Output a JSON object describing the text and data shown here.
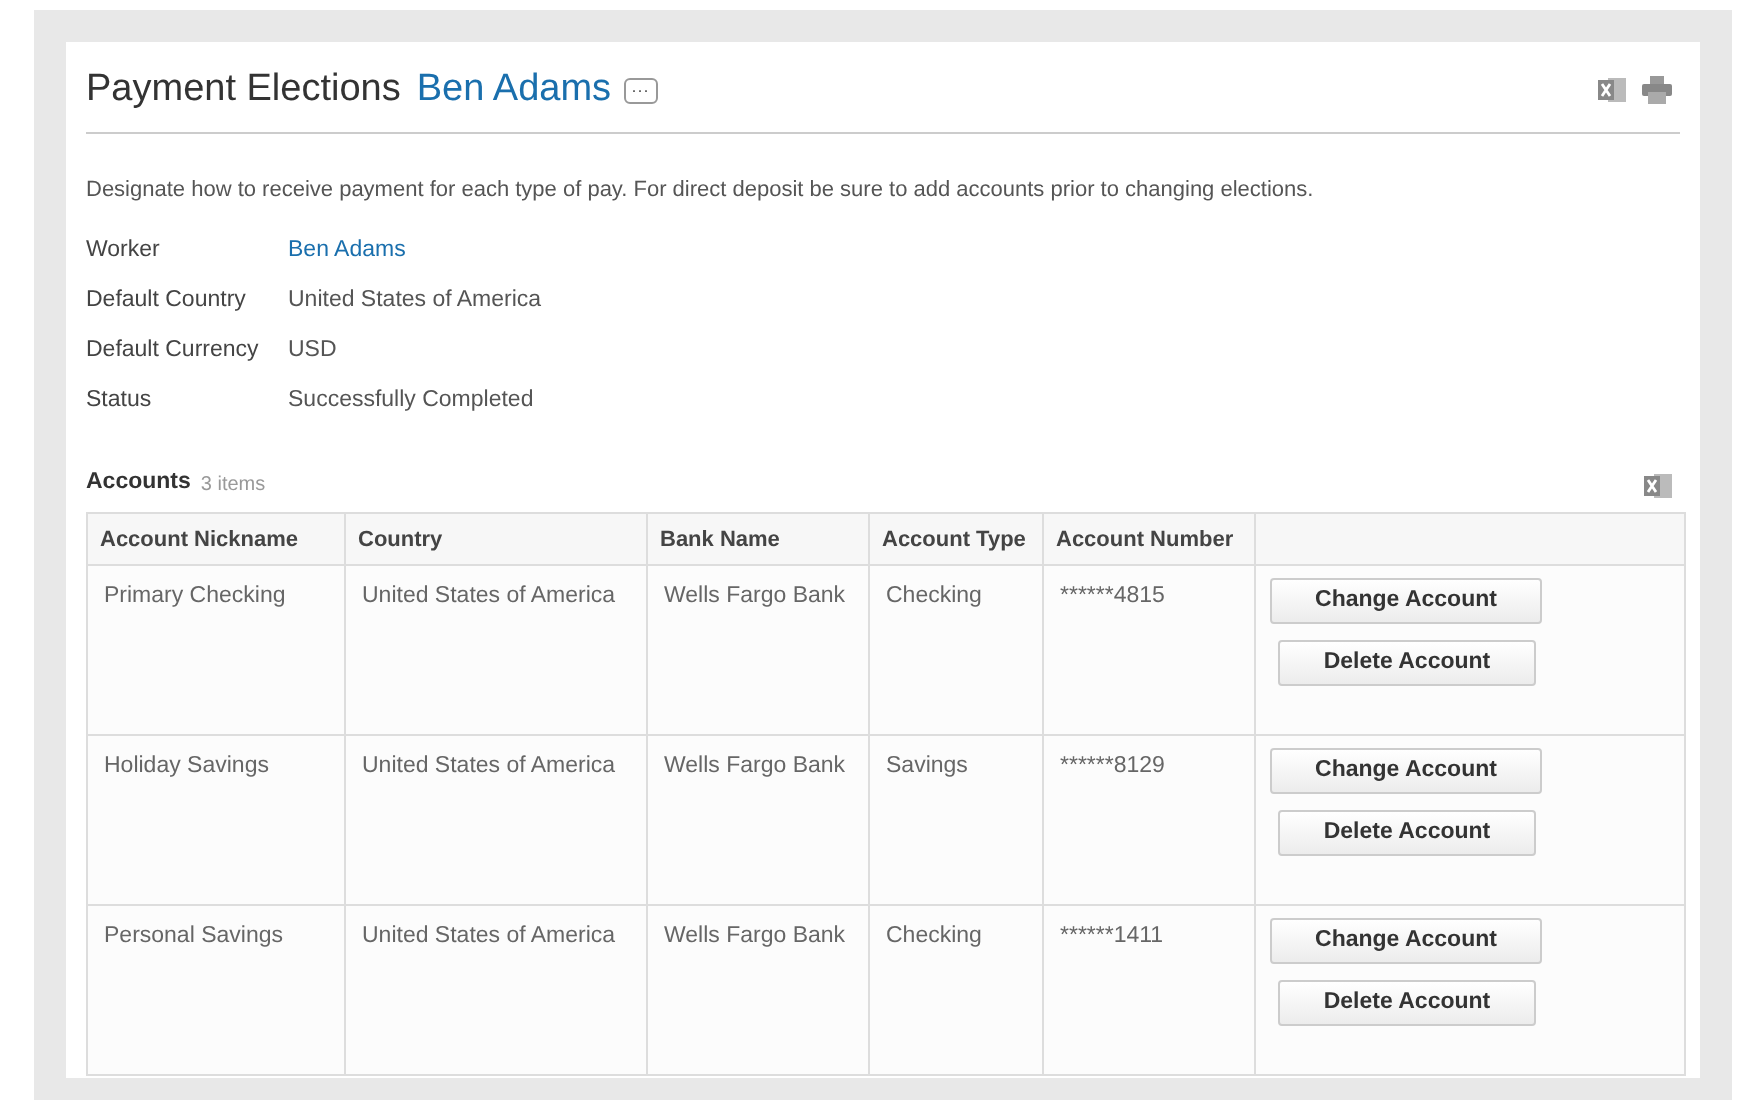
{
  "header": {
    "title": "Payment Elections",
    "worker_link": "Ben Adams",
    "more_button": "···"
  },
  "description": "Designate how to receive payment for each type of pay. For direct deposit be sure to add accounts prior to changing elections.",
  "fields": [
    {
      "label": "Worker",
      "value": "Ben Adams",
      "kind": "link"
    },
    {
      "label": "Default Country",
      "value": "United States of America",
      "kind": "text"
    },
    {
      "label": "Default Currency",
      "value": "USD",
      "kind": "text"
    },
    {
      "label": "Status",
      "value": "Successfully Completed",
      "kind": "text"
    }
  ],
  "accounts": {
    "title": "Accounts",
    "count": "3 items",
    "columns": [
      "Account Nickname",
      "Country",
      "Bank Name",
      "Account Type",
      "Account Number"
    ],
    "rows": [
      {
        "cells": [
          "Primary Checking",
          "United States of America",
          "Wells Fargo Bank",
          "Checking",
          "******4815"
        ],
        "buttons": [
          "Change Account",
          "Delete Account"
        ]
      },
      {
        "cells": [
          "Holiday Savings",
          "United States of America",
          "Wells Fargo Bank",
          "Savings",
          "******8129"
        ],
        "buttons": [
          "Change Account",
          "Delete Account"
        ]
      },
      {
        "cells": [
          "Personal Savings",
          "United States of America",
          "Wells Fargo Bank",
          "Checking",
          "******1411"
        ],
        "buttons": [
          "Change Account",
          "Delete Account"
        ]
      }
    ]
  }
}
